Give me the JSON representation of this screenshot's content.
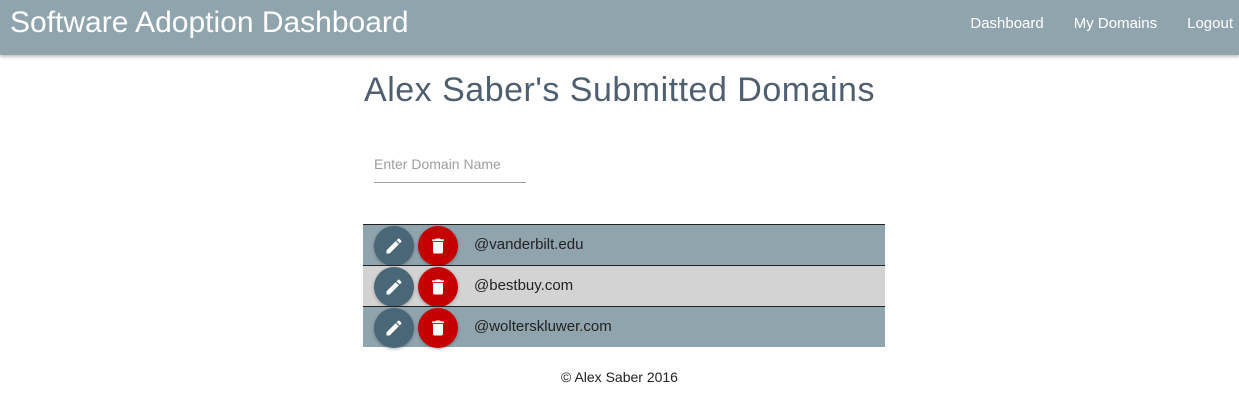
{
  "header": {
    "title": "Software Adoption Dashboard",
    "nav": [
      {
        "label": "Dashboard"
      },
      {
        "label": "My Domains"
      },
      {
        "label": "Logout"
      }
    ]
  },
  "main": {
    "title": "Alex Saber's Submitted Domains",
    "input": {
      "placeholder": "Enter Domain Name",
      "value": ""
    },
    "domains": [
      {
        "name": "@vanderbilt.edu"
      },
      {
        "name": "@bestbuy.com"
      },
      {
        "name": "@wolterskluwer.com"
      }
    ],
    "icons": {
      "edit": "pencil-icon",
      "delete": "trash-icon"
    }
  },
  "colors": {
    "header_bg": "#90a4ae",
    "row_alt": "#d3d3d3",
    "edit_button": "#4a6778",
    "delete_button": "#c40000"
  },
  "footer": {
    "text": "© Alex Saber 2016"
  }
}
